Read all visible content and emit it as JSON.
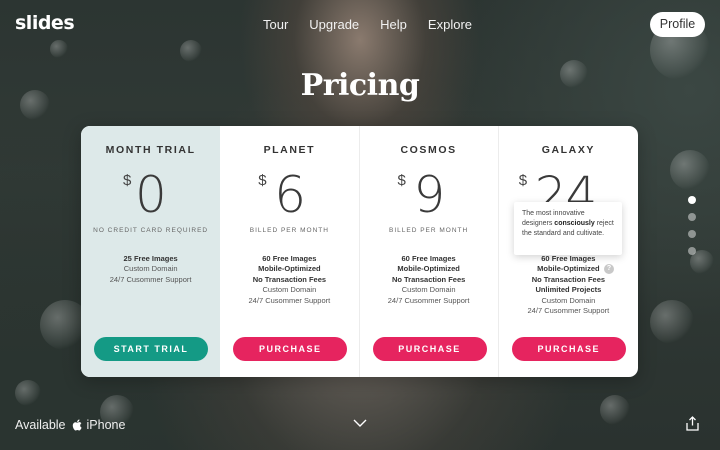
{
  "header": {
    "logo": "slides",
    "nav": [
      "Tour",
      "Upgrade",
      "Help",
      "Explore"
    ],
    "profile_label": "Profile"
  },
  "page_title": "Pricing",
  "plans": [
    {
      "name": "MONTH TRIAL",
      "currency": "$",
      "amount": "0",
      "subtitle": "NO CREDIT CARD REQUIRED",
      "features": [
        {
          "text": "25 Free Images",
          "bold": true
        },
        {
          "text": "Custom Domain",
          "bold": false
        },
        {
          "text": "24/7 Cusommer Support",
          "bold": false
        }
      ],
      "button": "START TRIAL"
    },
    {
      "name": "PLANET",
      "currency": "$",
      "amount": "6",
      "subtitle": "BILLED PER MONTH",
      "features": [
        {
          "text": "60 Free Images",
          "bold": true
        },
        {
          "text": "Mobile-Optimized",
          "bold": true
        },
        {
          "text": "No Transaction Fees",
          "bold": true
        },
        {
          "text": "Custom Domain",
          "bold": false
        },
        {
          "text": "24/7 Cusommer Support",
          "bold": false
        }
      ],
      "button": "PURCHASE"
    },
    {
      "name": "COSMOS",
      "currency": "$",
      "amount": "9",
      "subtitle": "BILLED PER MONTH",
      "features": [
        {
          "text": "60 Free Images",
          "bold": true
        },
        {
          "text": "Mobile-Optimized",
          "bold": true
        },
        {
          "text": "No Transaction Fees",
          "bold": true
        },
        {
          "text": "Custom Domain",
          "bold": false
        },
        {
          "text": "24/7 Cusommer Support",
          "bold": false
        }
      ],
      "button": "PURCHASE"
    },
    {
      "name": "GALAXY",
      "currency": "$",
      "amount": "24",
      "subtitle": "",
      "features": [
        {
          "text": "60 Free Images",
          "bold": true
        },
        {
          "text": "Mobile-Optimized",
          "bold": true
        },
        {
          "text": "No Transaction Fees",
          "bold": true
        },
        {
          "text": "Unlimited Projects",
          "bold": true
        },
        {
          "text": "Custom Domain",
          "bold": false
        },
        {
          "text": "24/7 Cusommer Support",
          "bold": false
        }
      ],
      "button": "PURCHASE"
    }
  ],
  "tooltip": {
    "before": "The most innovative designers ",
    "bold": "consciously",
    "after": " reject the standard and cultivate."
  },
  "info_icon": "?",
  "pager": {
    "count": 4,
    "active_index": 0
  },
  "footer": {
    "available_label": "Available",
    "platform": "iPhone"
  },
  "colors": {
    "trial_bg": "#dde9e9",
    "teal": "#149a85",
    "pink": "#e6245f"
  },
  "icons": [
    "apple-icon",
    "chevron-down-icon",
    "share-icon",
    "info-icon"
  ]
}
